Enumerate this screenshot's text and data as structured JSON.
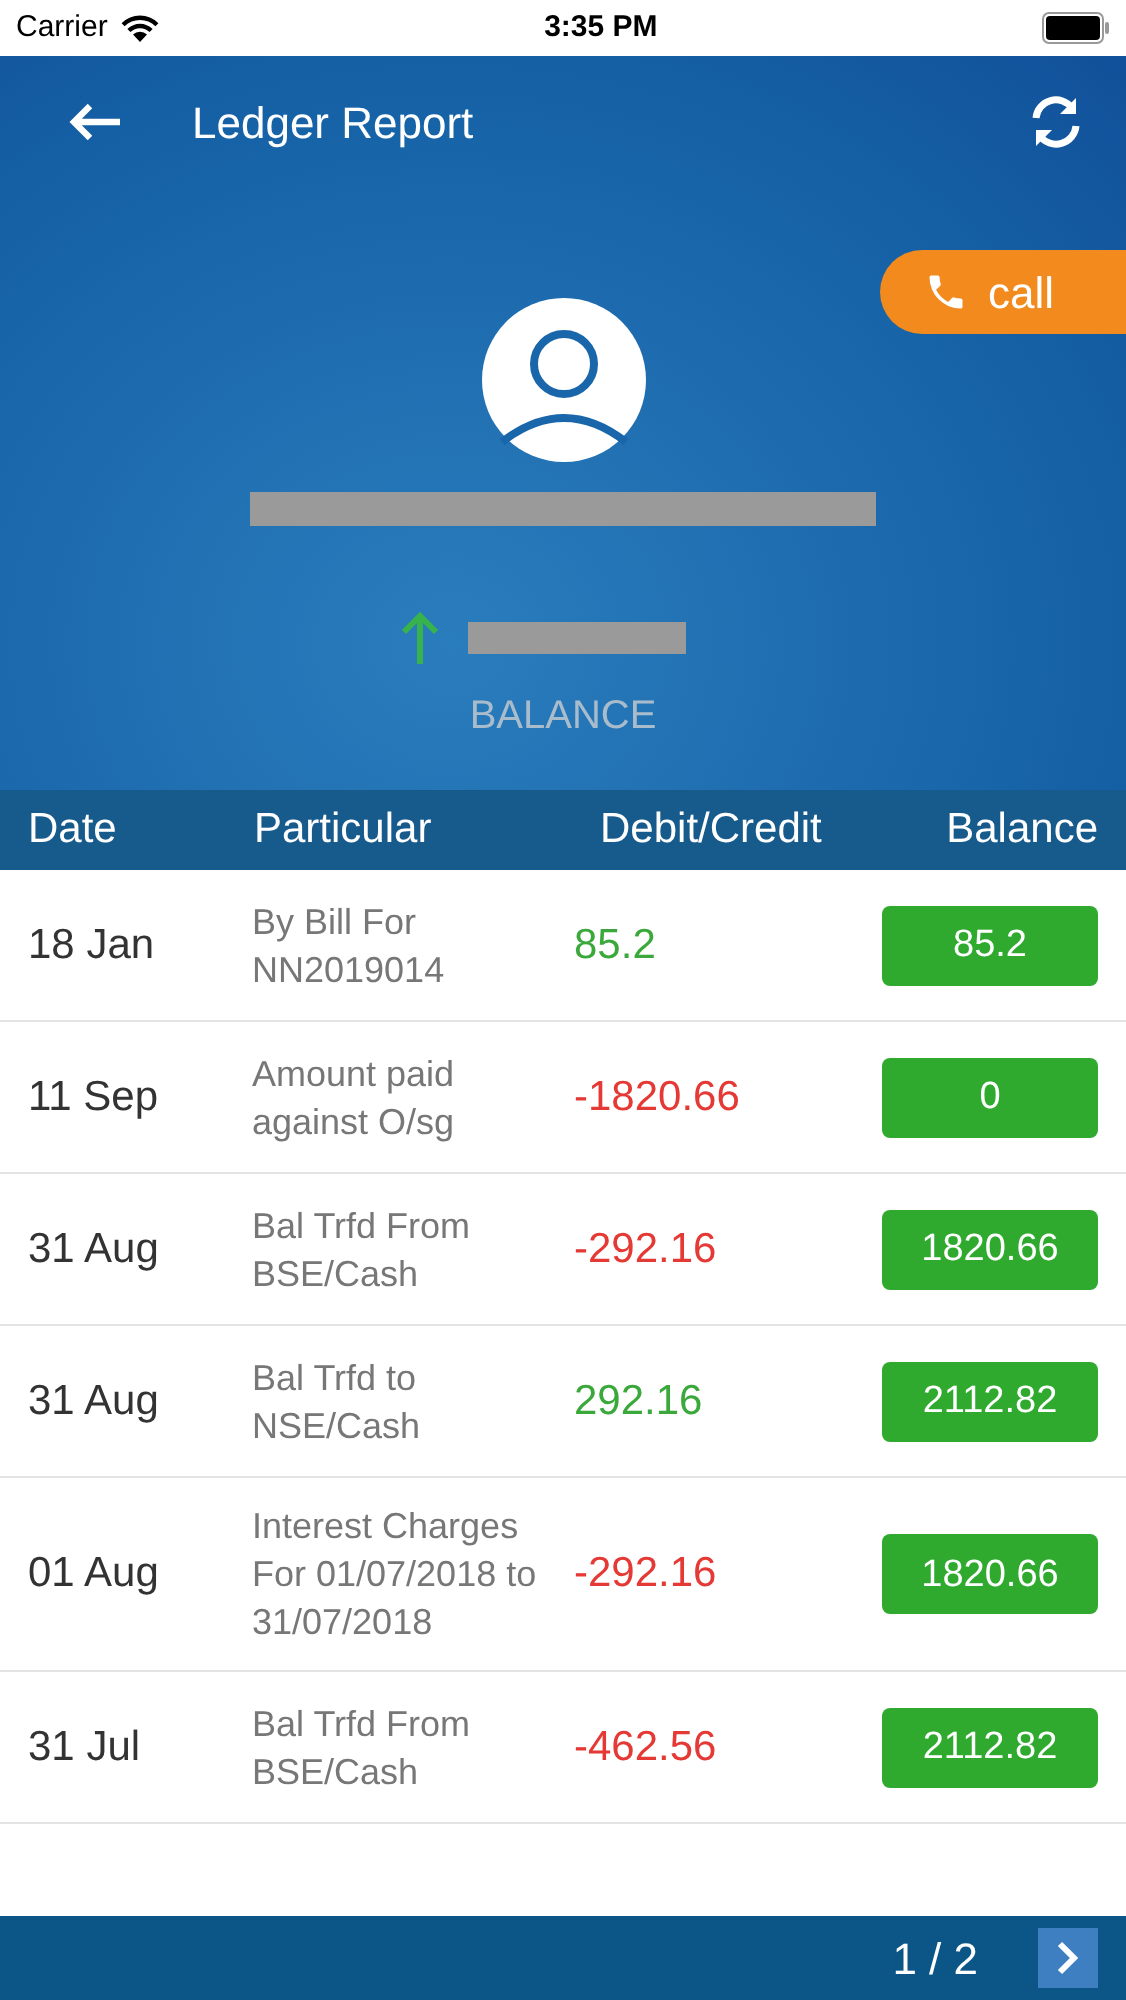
{
  "status_bar": {
    "carrier": "Carrier",
    "time": "3:35 PM"
  },
  "header": {
    "title": "Ledger Report",
    "call_label": "call",
    "balance_label": "BALANCE",
    "trend_up": true
  },
  "table": {
    "columns": [
      "Date",
      "Particular",
      "Debit/Credit",
      "Balance"
    ],
    "rows": [
      {
        "date": "18 Jan",
        "particular": "By Bill For NN2019014",
        "amount": "85.2",
        "kind": "credit",
        "balance": "85.2"
      },
      {
        "date": "11 Sep",
        "particular": "Amount paid against O/sg",
        "amount": "-1820.66",
        "kind": "debit",
        "balance": "0"
      },
      {
        "date": "31 Aug",
        "particular": "Bal Trfd From BSE/Cash",
        "amount": "-292.16",
        "kind": "debit",
        "balance": "1820.66"
      },
      {
        "date": "31 Aug",
        "particular": "Bal Trfd to NSE/Cash",
        "amount": "292.16",
        "kind": "credit",
        "balance": "2112.82"
      },
      {
        "date": "01 Aug",
        "particular": "Interest Charges For 01/07/2018 to 31/07/2018",
        "amount": "-292.16",
        "kind": "debit",
        "balance": "1820.66"
      },
      {
        "date": "31 Jul",
        "particular": "Bal Trfd From BSE/Cash",
        "amount": "-462.56",
        "kind": "debit",
        "balance": "2112.82"
      }
    ]
  },
  "pager": {
    "page": "1 / 2"
  }
}
